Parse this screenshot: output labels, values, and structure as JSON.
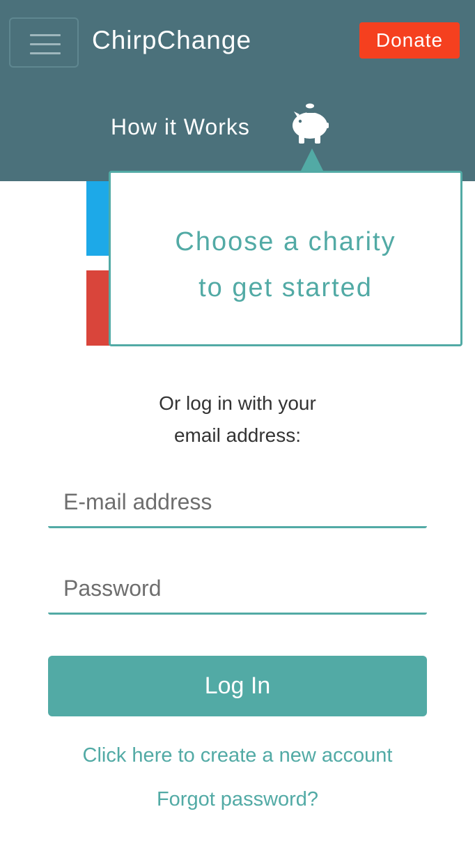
{
  "header": {
    "brand": "ChirpChange",
    "donate_label": "Donate",
    "how_it_works_label": "How it Works",
    "menu_icon": "hamburger-menu-icon",
    "piggy_icon": "piggy-bank-icon"
  },
  "tooltip": {
    "line1": "Choose a charity",
    "line2": "to get started"
  },
  "login": {
    "prompt_line1": "Or log in with your",
    "prompt_line2": "email address:",
    "email_placeholder": "E-mail address",
    "email_value": "",
    "password_placeholder": "Password",
    "password_value": "",
    "login_button": "Log In",
    "create_account_link": "Click here to create a new account",
    "forgot_password_link": "Forgot password?"
  },
  "colors": {
    "header_bg": "#4b717b",
    "accent": "#52aaa5",
    "donate": "#f5401f",
    "twitter_blue": "#1da9e8",
    "red": "#d9453b"
  }
}
